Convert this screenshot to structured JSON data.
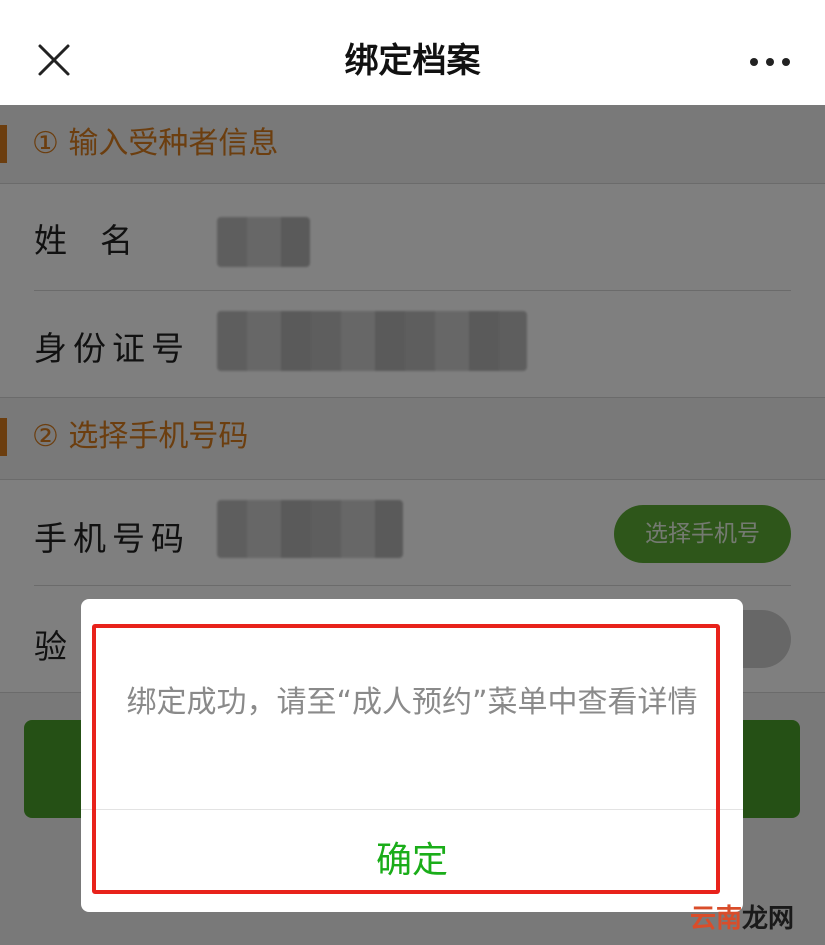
{
  "navbar": {
    "title": "绑定档案",
    "close_icon": "close-icon",
    "more_icon": "more-icon"
  },
  "sections": [
    {
      "title": "① 输入受种者信息"
    },
    {
      "title": "② 选择手机号码"
    }
  ],
  "form": {
    "name_label": "姓　名",
    "id_label": "身份证号",
    "phone_label": "手机号码",
    "pick_phone_button": "选择手机号",
    "code_label": "验"
  },
  "dialog": {
    "message": "绑定成功，请至“成人预约”菜单中查看详情",
    "confirm_label": "确定"
  },
  "watermark": {
    "part1": "云南",
    "part2": "龙网"
  },
  "colors": {
    "accent_orange": "#d97d1e",
    "primary_green": "#1aad19",
    "highlight_red": "#e8221b"
  }
}
